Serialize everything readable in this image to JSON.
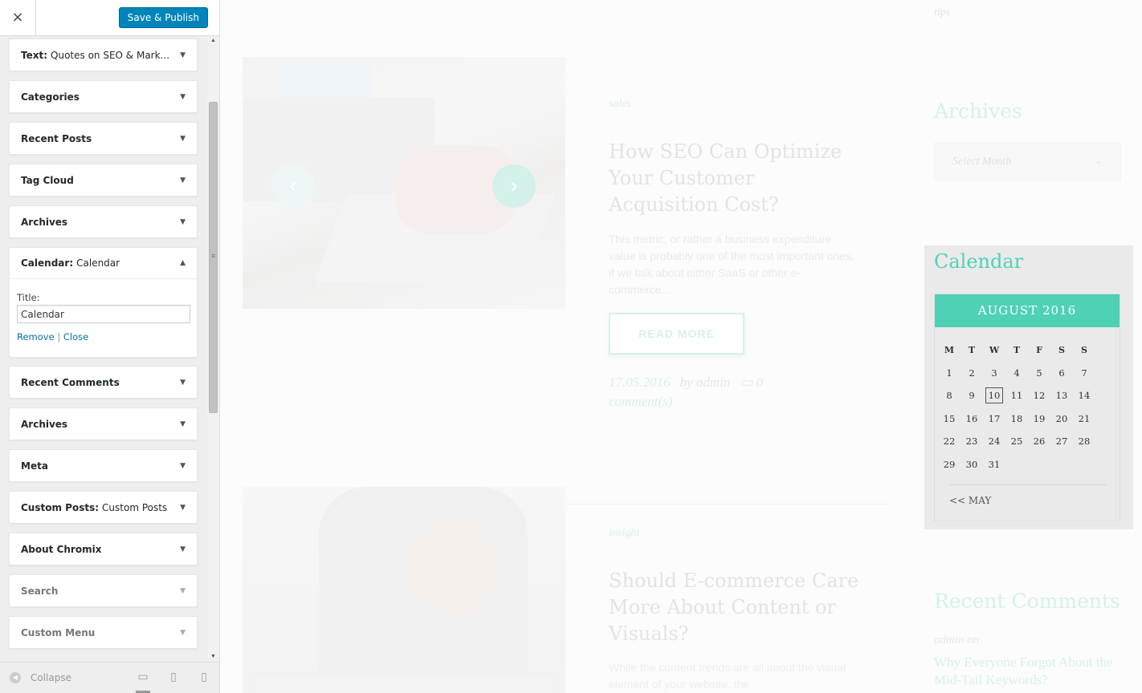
{
  "customizer": {
    "close_icon": "×",
    "publish_label": "Save & Publish",
    "widgets": [
      {
        "title": "Text",
        "instance": "Quotes on SEO & Mark..."
      },
      {
        "title": "Categories",
        "instance": ""
      },
      {
        "title": "Recent Posts",
        "instance": ""
      },
      {
        "title": "Tag Cloud",
        "instance": ""
      },
      {
        "title": "Archives",
        "instance": ""
      },
      {
        "title": "Calendar",
        "instance": "Calendar",
        "open": true,
        "field_label": "Title:",
        "field_value": "Calendar",
        "remove_label": "Remove",
        "separator": "|",
        "close_label": "Close"
      },
      {
        "title": "Recent Comments",
        "instance": ""
      },
      {
        "title": "Archives",
        "instance": ""
      },
      {
        "title": "Meta",
        "instance": ""
      },
      {
        "title": "Custom Posts",
        "instance": "Custom Posts"
      },
      {
        "title": "About Chromix",
        "instance": ""
      },
      {
        "title": "Search",
        "instance": ""
      },
      {
        "title": "Custom Menu",
        "instance": ""
      }
    ],
    "footer": {
      "collapse_label": "Collapse",
      "devices": [
        "desktop-icon",
        "tablet-icon",
        "mobile-icon"
      ],
      "active_device": "desktop"
    },
    "accent_color": "#0085ba"
  },
  "preview": {
    "tips_text": "tips",
    "archives_title": "Archives",
    "archives_select": "Select Month",
    "posts": [
      {
        "category": "sales",
        "title": "How SEO Can Optimize Your Customer Acquisition Cost?",
        "excerpt": "This metric, or rather a business expenditure value is probably one of the most important ones, if we talk about either SaaS or other e-commerce...",
        "read_more": "READ MORE",
        "date": "17.05.2016",
        "author": "by admin",
        "comments": "0 comment(s)"
      },
      {
        "category": "insight",
        "title": "Should E-commerce Care More About Content or Visuals?",
        "excerpt": "While the content trends are all about the visual element of your website, the"
      }
    ],
    "calendar": {
      "title": "Calendar",
      "caption": "AUGUST 2016",
      "weekdays": [
        "M",
        "T",
        "W",
        "T",
        "F",
        "S",
        "S"
      ],
      "weeks": [
        [
          "1",
          "2",
          "3",
          "4",
          "5",
          "6",
          "7"
        ],
        [
          "8",
          "9",
          "10",
          "11",
          "12",
          "13",
          "14"
        ],
        [
          "15",
          "16",
          "17",
          "18",
          "19",
          "20",
          "21"
        ],
        [
          "22",
          "23",
          "24",
          "25",
          "26",
          "27",
          "28"
        ],
        [
          "29",
          "30",
          "31",
          "",
          "",
          "",
          ""
        ]
      ],
      "today": "10",
      "prev_link": "<< MAY",
      "accent_color": "#4fd1b6"
    },
    "recent_comments": {
      "title": "Recent Comments",
      "author": "admin on",
      "link": "Why Everyone Forgot About the Mid-Tail Keywords?"
    }
  }
}
